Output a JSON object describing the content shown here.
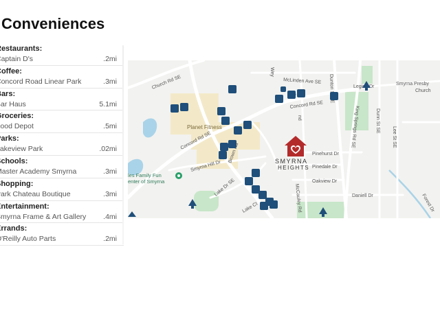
{
  "page": {
    "title": "Conveniences"
  },
  "categories": [
    {
      "label": "Restaurants:",
      "place": "Captain D's",
      "distance": ".2mi"
    },
    {
      "label": "Coffee:",
      "place": "Concord Road Linear Park",
      "distance": ".3mi"
    },
    {
      "label": "Bars:",
      "place": "Bar Haus",
      "distance": "5.1mi"
    },
    {
      "label": "Groceries:",
      "place": "Food Depot",
      "distance": ".5mi"
    },
    {
      "label": "Parks:",
      "place": "Lakeview Park",
      "distance": ".02mi"
    },
    {
      "label": "Schools:",
      "place": "Master Academy Smyrna",
      "distance": ".3mi"
    },
    {
      "label": "Shopping:",
      "place": "Park Chateau Boutique",
      "distance": ".3mi"
    },
    {
      "label": "Entertainment:",
      "place": "Smyrna Frame & Art Gallery",
      "distance": ".4mi"
    },
    {
      "label": "Errands:",
      "place": "O'Reilly Auto Parts",
      "distance": ".2mi"
    }
  ],
  "map": {
    "streets": {
      "church_rd": "Church Rd SE",
      "concord_rd_1": "Concord Rd SE",
      "concord_rd_2": "Concord Rd SE",
      "mcclinden": "McLinden Ave SE",
      "dunton": "Dunton St SE",
      "king_springs": "King Springs Rd SE",
      "dunn": "Dunn St SE",
      "lee": "Lee St SE",
      "pinehurst": "Pinehurst Dr",
      "pinedale": "Pinedale Dr",
      "oakview": "Oakview Dr",
      "daniell": "Daniell Dr",
      "smyrna_hill": "Smyrna Hill Dr",
      "brown": "Brown Rd",
      "lake_dr": "Lake Dr SE",
      "lake_ct": "Lake Ct",
      "mccauley": "McCauley Rd",
      "forest": "Forest Dr",
      "legion": "Legion Dr",
      "smyrna_presby": "Smyrna Presby",
      "church": "Church",
      "wey": "Wey",
      "de": "De",
      "nd": "nd"
    },
    "places": {
      "planet_fitness": "Planet Fitness",
      "family_fun_1": "les Family Fun",
      "family_fun_2": "enter of Smyrna"
    },
    "neighborhood": {
      "line1": "SMYRNA",
      "line2": "HEIGHTS"
    },
    "colors": {
      "background": "#f2f2f0",
      "road": "#ffffff",
      "park": "#c8e6c9",
      "commercial": "#f3e9c9",
      "water": "#a9d3e8",
      "poi": "#1f4f7a",
      "home_marker": "#b32b2b"
    }
  }
}
